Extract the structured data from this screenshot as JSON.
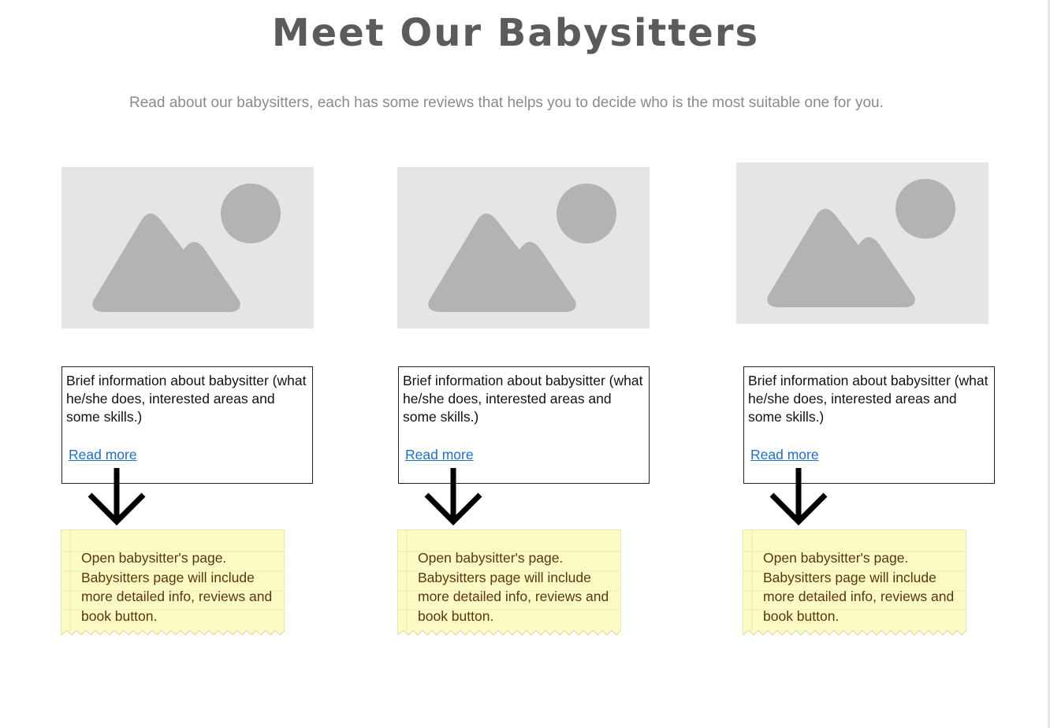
{
  "header": {
    "title": "Meet Our Babysitters",
    "subtitle": "Read about our babysitters, each has some reviews that helps you to decide who is the most suitable one for you."
  },
  "cards": [
    {
      "image_icon": "image-placeholder-icon",
      "info": "Brief information about babysitter (what he/she does, interested areas and some skills.)",
      "link": "Read more",
      "note": "Open babysitter's page. Babysitters page will include more detailed info, reviews and book button."
    },
    {
      "image_icon": "image-placeholder-icon",
      "info": "Brief information about babysitter (what he/she does, interested areas and some skills.)",
      "link": "Read more",
      "note": "Open babysitter's page. Babysitters page will include more detailed info, reviews and book button."
    },
    {
      "image_icon": "image-placeholder-icon",
      "info": "Brief information about babysitter (what he/she does, interested areas and some skills.)",
      "link": "Read more",
      "note": "Open babysitter's page. Babysitters page will include more detailed info, reviews and book button."
    }
  ],
  "colors": {
    "title": "#5b5b5b",
    "subtitle": "#8a8a8a",
    "placeholder_bg": "#e5e5e5",
    "placeholder_shape": "#b3b3b3",
    "link": "#1a6fd1",
    "note_bg": "#fdfbc4",
    "note_text": "#5a3510"
  }
}
